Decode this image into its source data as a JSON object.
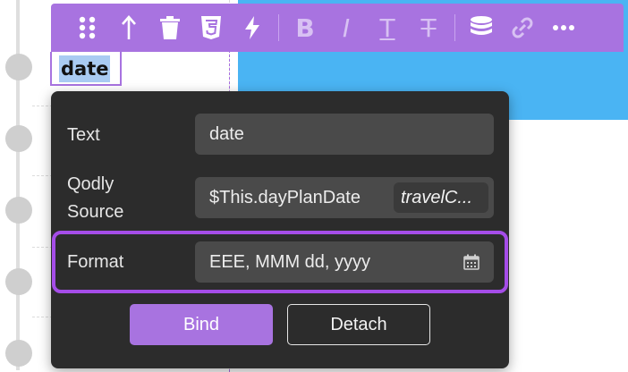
{
  "toolbar": {
    "buttons": [
      {
        "name": "drag-handle-icon"
      },
      {
        "name": "move-up-icon"
      },
      {
        "name": "trash-icon"
      },
      {
        "name": "css-icon"
      },
      {
        "name": "lightning-icon"
      },
      {
        "name": "bold-icon",
        "glyph": "B"
      },
      {
        "name": "italic-icon",
        "glyph": "I"
      },
      {
        "name": "underline-icon",
        "glyph": "T"
      },
      {
        "name": "strikethrough-icon",
        "glyph": "T"
      },
      {
        "name": "datasource-icon"
      },
      {
        "name": "link-icon"
      },
      {
        "name": "more-icon"
      }
    ],
    "background": "#a873e0"
  },
  "element": {
    "text": "date"
  },
  "popover": {
    "text_label": "Text",
    "text_value": "date",
    "source_label_line1": "Qodly",
    "source_label_line2": "Source",
    "source_value": "$This.dayPlanDate",
    "source_chip": "travelC...",
    "format_label": "Format",
    "format_value": "EEE, MMM dd, yyyy",
    "bind_label": "Bind",
    "detach_label": "Detach",
    "highlight_color": "#a54de8"
  }
}
